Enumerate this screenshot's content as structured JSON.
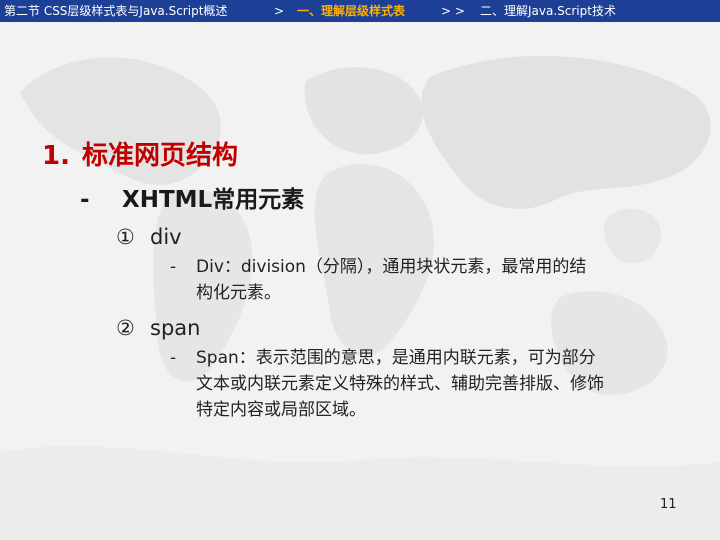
{
  "nav": {
    "section": "第二节 CSS层级样式表与Java.Script概述",
    "separator1": ">",
    "current": "一、理解层级样式表",
    "separator2": "> >",
    "next": "二、理解Java.Script技术"
  },
  "slide": {
    "heading_number": "1.",
    "heading_text": "标准网页结构",
    "subheading_dash": "-",
    "subheading_text": "XHTML常用元素",
    "items": [
      {
        "marker": "①",
        "title": "div",
        "desc_dash": "-",
        "desc_lines": [
          "Div：division（分隔），通用块状元素，最常用的结",
          "构化元素。"
        ]
      },
      {
        "marker": "②",
        "title": "span",
        "desc_dash": "-",
        "desc_lines": [
          "Span：表示范围的意思，是通用内联元素，可为部分",
          "文本或内联元素定义特殊的样式、辅助完善排版、修饰",
          "特定内容或局部区域。"
        ]
      }
    ],
    "page_number": "11"
  },
  "colors": {
    "nav_background": "#1d3f95",
    "nav_active": "#ffb000",
    "heading": "#c00000",
    "background": "#f1f1f1"
  }
}
